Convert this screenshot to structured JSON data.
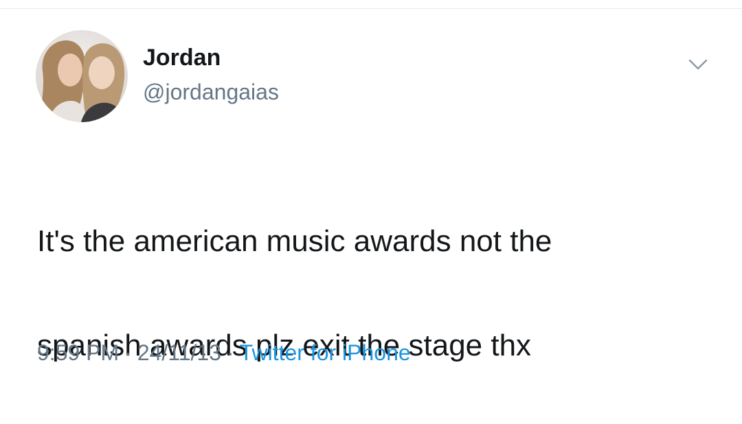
{
  "tweet": {
    "author": {
      "display_name": "Jordan",
      "handle": "@jordangaias"
    },
    "text_line1": "It's the american music awards not the",
    "text_line2": "spanish awards plz exit the stage thx",
    "time": "9:59 PM",
    "date": "24/11/13",
    "separator": "·",
    "source": "Twitter for iPhone"
  },
  "icons": {
    "menu": "chevron-down-icon",
    "avatar": "profile-photo"
  },
  "colors": {
    "text": "#14171a",
    "secondary": "#657786",
    "link": "#1b95e0"
  }
}
